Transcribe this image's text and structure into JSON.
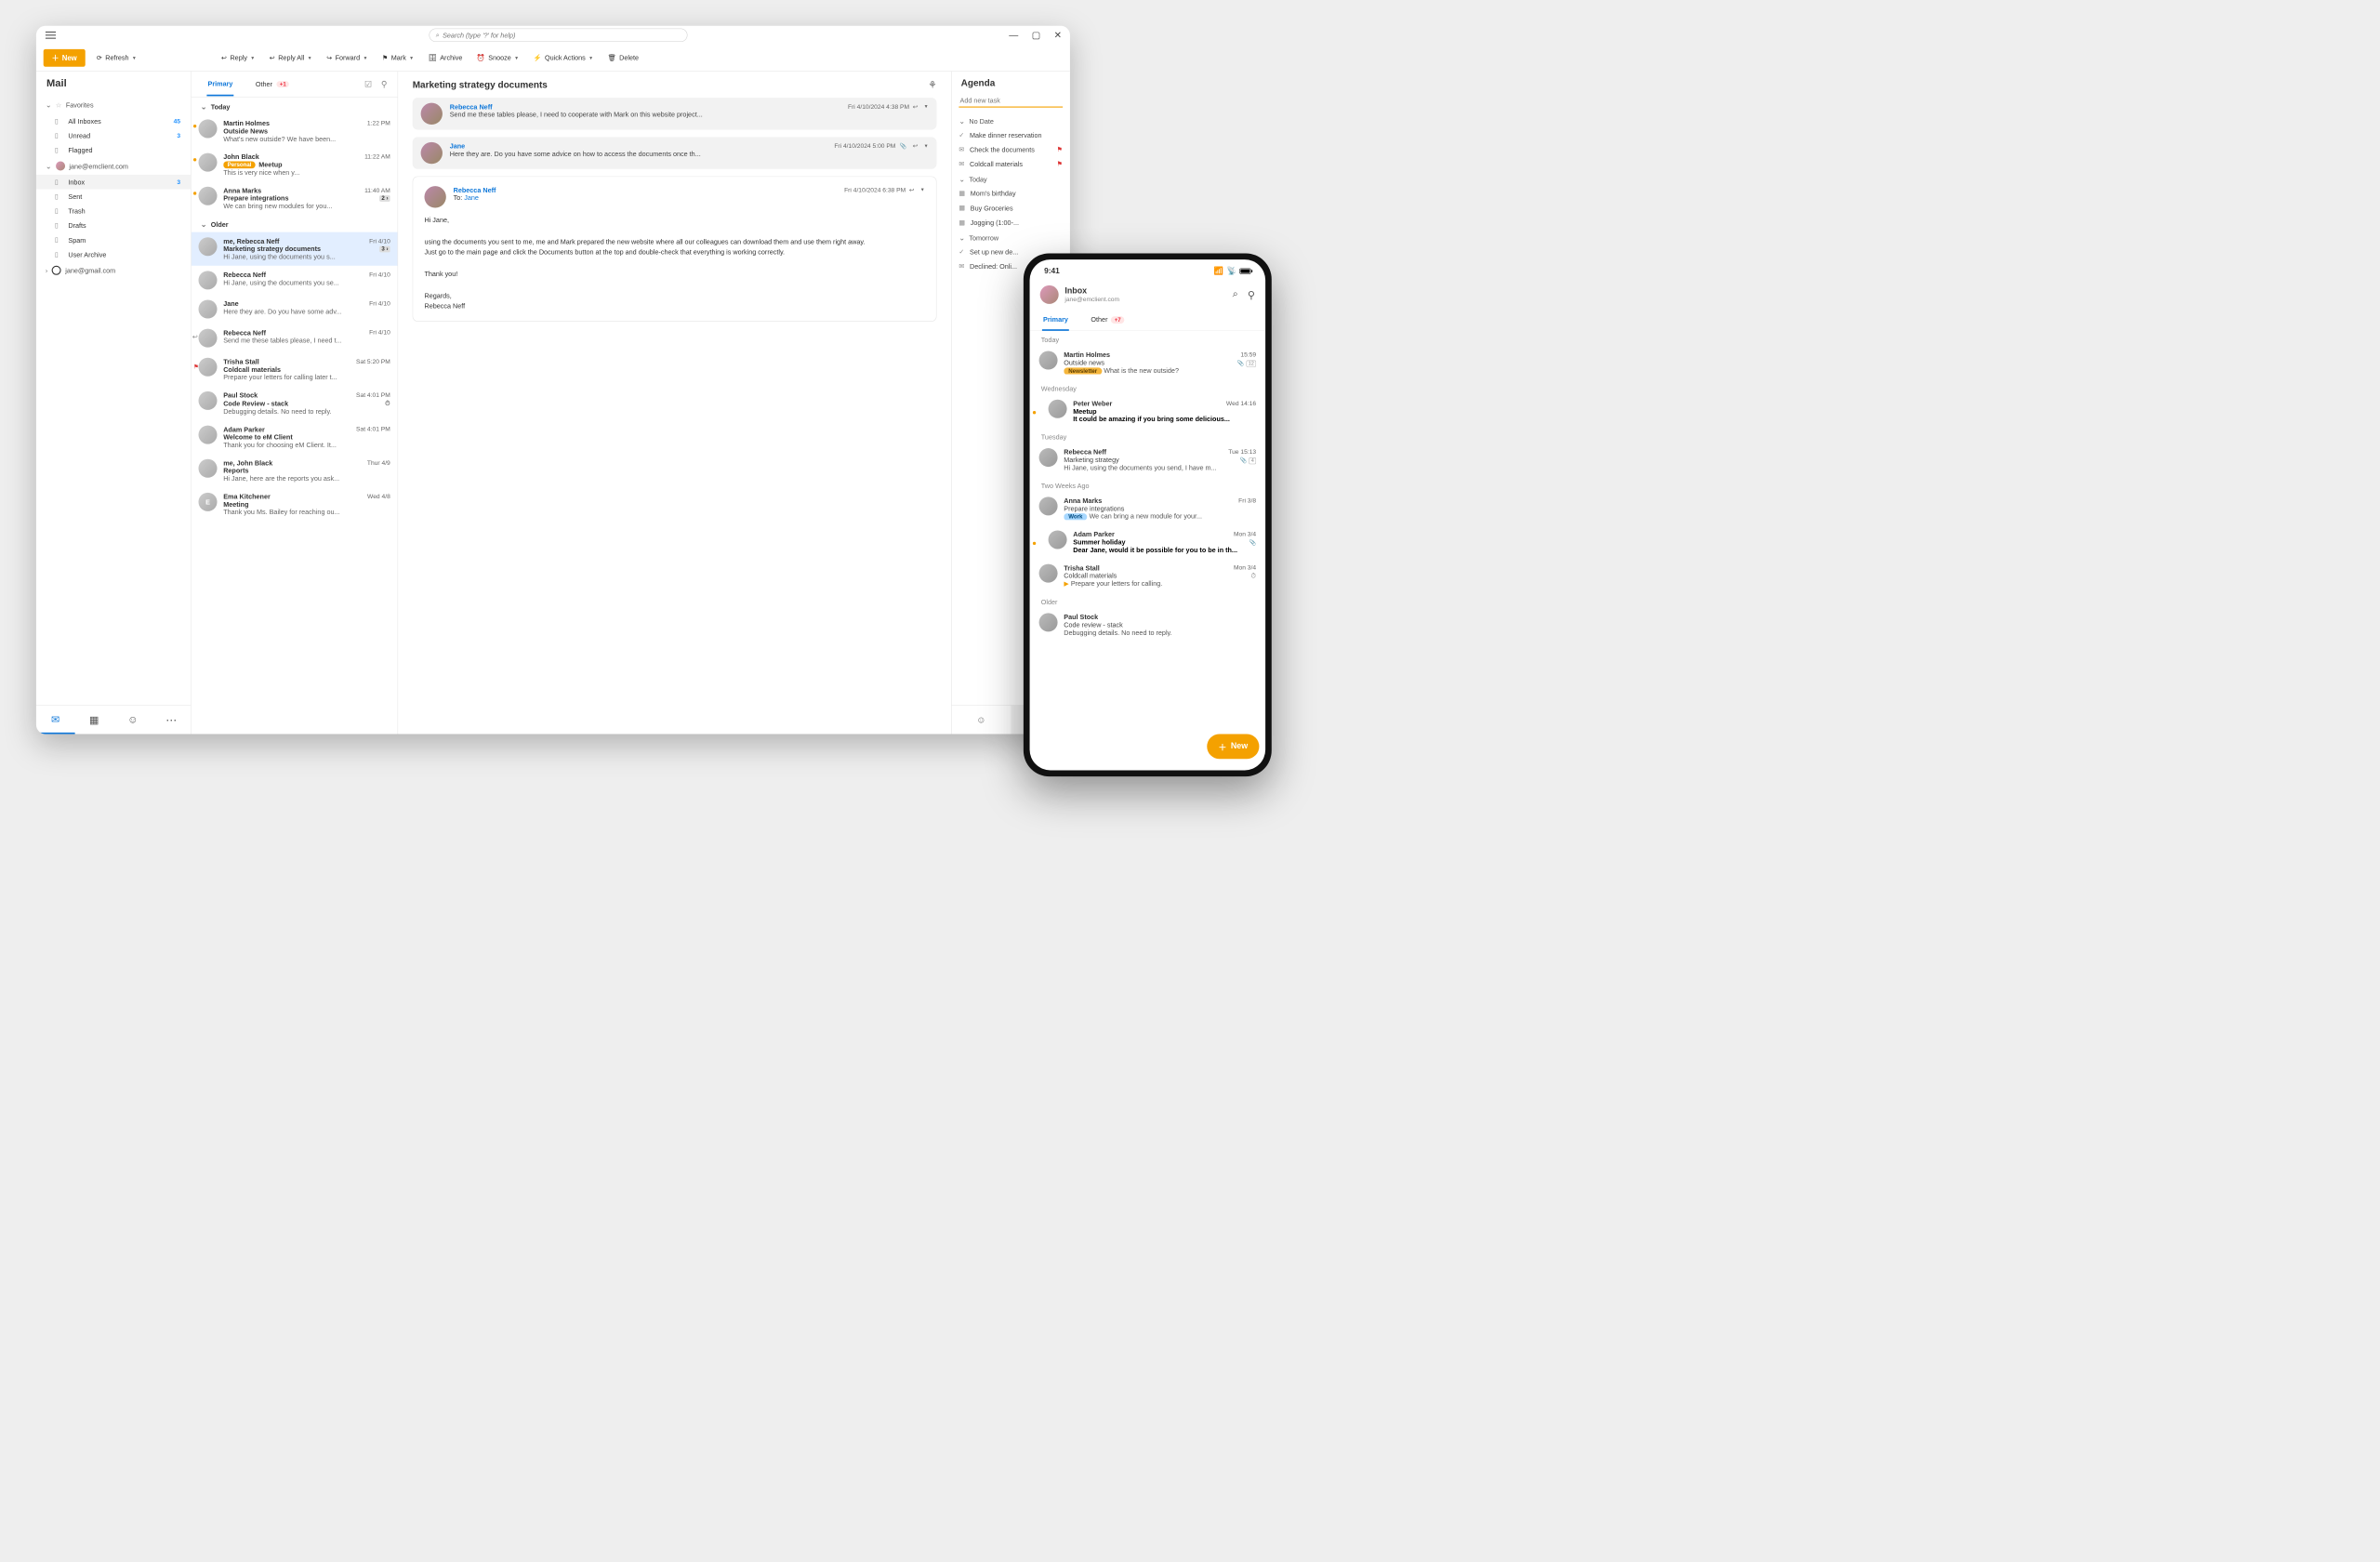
{
  "search_placeholder": "Search (type '?' for help)",
  "new_btn": "New",
  "toolbar": {
    "refresh": "Refresh",
    "reply": "Reply",
    "replyall": "Reply All",
    "forward": "Forward",
    "mark": "Mark",
    "archive": "Archive",
    "snooze": "Snooze",
    "quick": "Quick Actions",
    "delete": "Delete"
  },
  "nav": {
    "title": "Mail",
    "fav": "Favorites",
    "items": [
      {
        "label": "All Inboxes",
        "count": "45"
      },
      {
        "label": "Unread",
        "count": "3"
      },
      {
        "label": "Flagged"
      }
    ],
    "acct1": "jane@emclient.com",
    "acct1items": [
      {
        "label": "Inbox",
        "count": "3",
        "sel": true
      },
      {
        "label": "Sent"
      },
      {
        "label": "Trash"
      },
      {
        "label": "Drafts"
      },
      {
        "label": "Spam"
      },
      {
        "label": "User Archive"
      }
    ],
    "acct2": "jane@gmail.com"
  },
  "tabs": {
    "primary": "Primary",
    "other": "Other",
    "other_badge": "+1"
  },
  "groups": {
    "today": "Today",
    "older": "Older"
  },
  "messages_today": [
    {
      "from": "Martin Holmes",
      "time": "1:22 PM",
      "subj": "Outside News",
      "prev": "What's new outside? We have been...",
      "dot": true
    },
    {
      "from": "John Black",
      "time": "11:22 AM",
      "subj": "Meetup",
      "prev": "This is very nice when y...",
      "dot": true,
      "pill": "Personal"
    },
    {
      "from": "Anna Marks",
      "time": "11:40 AM",
      "subj": "Prepare integrations",
      "prev": "We can bring new modules for you...",
      "dot": true,
      "badge": "2"
    }
  ],
  "messages_older": [
    {
      "from": "me, Rebecca Neff",
      "time": "Fri 4/10",
      "subj": "Marketing strategy documents",
      "prev": "Hi Jane, using the documents you s...",
      "sel": true,
      "badge": "3"
    },
    {
      "from": "Rebecca Neff",
      "time": "Fri 4/10",
      "subj": "",
      "prev": "Hi Jane, using the documents you se..."
    },
    {
      "from": "Jane",
      "time": "Fri 4/10",
      "subj": "",
      "prev": "Here they are. Do you have some adv..."
    },
    {
      "from": "Rebecca Neff",
      "time": "Fri 4/10",
      "subj": "",
      "prev": "Send me these tables please, I need t...",
      "reply": true
    },
    {
      "from": "Trisha Stall",
      "time": "Sat 5:20 PM",
      "subj": "Coldcall materials",
      "prev": "Prepare your letters for calling later t...",
      "flag": true
    },
    {
      "from": "Paul Stock",
      "time": "Sat 4:01 PM",
      "subj": "Code Review - stack",
      "prev": "Debugging details. No need to reply.",
      "snz": true
    },
    {
      "from": "Adam Parker",
      "time": "Sat 4:01 PM",
      "subj": "Welcome to eM Client",
      "prev": "Thank you for choosing eM Client. It..."
    },
    {
      "from": "me, John Black",
      "time": "Thur 4/9",
      "subj": "Reports",
      "prev": "Hi Jane, here are the reports you ask..."
    },
    {
      "from": "Ema Kitchener",
      "time": "Wed 4/8",
      "subj": "Meeting",
      "prev": "Thank you Ms. Bailey for reaching ou...",
      "avtxt": "E"
    }
  ],
  "reader": {
    "subject": "Marketing strategy documents",
    "thread": [
      {
        "name": "Rebecca Neff",
        "date": "Fri 4/10/2024 4:38 PM",
        "prev": "Send me these tables please, I need to cooperate with Mark on this website project..."
      },
      {
        "name": "Jane",
        "date": "Fri 4/10/2024 5:00 PM",
        "prev": "Here they are. Do you have some advice on how to access the documents once th...",
        "clip": true
      }
    ],
    "open": {
      "name": "Rebecca Neff",
      "date": "Fri 4/10/2024 6:38 PM",
      "to_label": "To:",
      "to": "Jane",
      "body": "Hi Jane,\n\nusing the documents you sent to me, me and Mark prepared the new website where all our colleagues can download them and use them right away.\nJust go to the main page and click the Documents button at the top and double-check that everything is working correctly.\n\nThank you!\n\nRegards,\nRebecca Neff"
    }
  },
  "agenda": {
    "title": "Agenda",
    "add": "Add new task",
    "grp": {
      "nodate": "No Date",
      "today": "Today",
      "tomorrow": "Tomorrow"
    },
    "nodate": [
      {
        "text": "Make dinner reservation",
        "ic": "check"
      },
      {
        "text": "Check the documents",
        "ic": "mail",
        "flag": true
      },
      {
        "text": "Coldcall materials",
        "ic": "mail",
        "flag": true
      }
    ],
    "today": [
      {
        "text": "Mom's birthday",
        "ic": "cal"
      },
      {
        "text": "Buy Groceries",
        "ic": "cal"
      },
      {
        "text": "Jogging (1:00-...",
        "ic": "cal"
      }
    ],
    "tomorrow": [
      {
        "text": "Set up new de...",
        "ic": "check"
      },
      {
        "text": "Declined: Onli...",
        "ic": "mail"
      }
    ]
  },
  "phone": {
    "time": "9:41",
    "inbox": "Inbox",
    "acct": "jane@emclient.com",
    "tabs": {
      "primary": "Primary",
      "other": "Other",
      "badge": "+7"
    },
    "grp": {
      "today": "Today",
      "wed": "Wednesday",
      "tue": "Tuesday",
      "two": "Two Weeks Ago",
      "older": "Older"
    },
    "msgs": {
      "today": [
        {
          "from": "Martin Holmes",
          "time": "15:59",
          "subj": "Outside news",
          "prev": "What is the new outside?",
          "pill": "Newsletter",
          "clip": true,
          "cnt": "12"
        }
      ],
      "wed": [
        {
          "from": "Peter Weber",
          "time": "Wed 14:16",
          "subj": "Meetup",
          "prev": "It could be amazing if you bring some delicious...",
          "dot": true,
          "bold": true
        }
      ],
      "tue": [
        {
          "from": "Rebecca Neff",
          "time": "Tue 15:13",
          "subj": "Marketing strategy",
          "prev": "Hi Jane, using the documents you send, I have m...",
          "clip": true,
          "cnt": "4"
        }
      ],
      "two": [
        {
          "from": "Anna Marks",
          "time": "Fri 3/8",
          "subj": "Prepare integrations",
          "prev": "We can bring a new module for your...",
          "pill": "Work"
        },
        {
          "from": "Adam Parker",
          "time": "Mon 3/4",
          "subj": "Summer holiday",
          "prev": "Dear Jane, would it be possible for you to be in th...",
          "dot": true,
          "bold": true,
          "clip": true
        },
        {
          "from": "Trisha Stall",
          "time": "Mon 3/4",
          "subj": "Coldcall materials",
          "prev": "Prepare your letters for calling.",
          "snz": true,
          "tag": true
        }
      ],
      "older": [
        {
          "from": "Paul Stock",
          "time": "",
          "subj": "Code review - stack",
          "prev": "Debugging details. No need to reply."
        }
      ]
    },
    "new": "New"
  }
}
